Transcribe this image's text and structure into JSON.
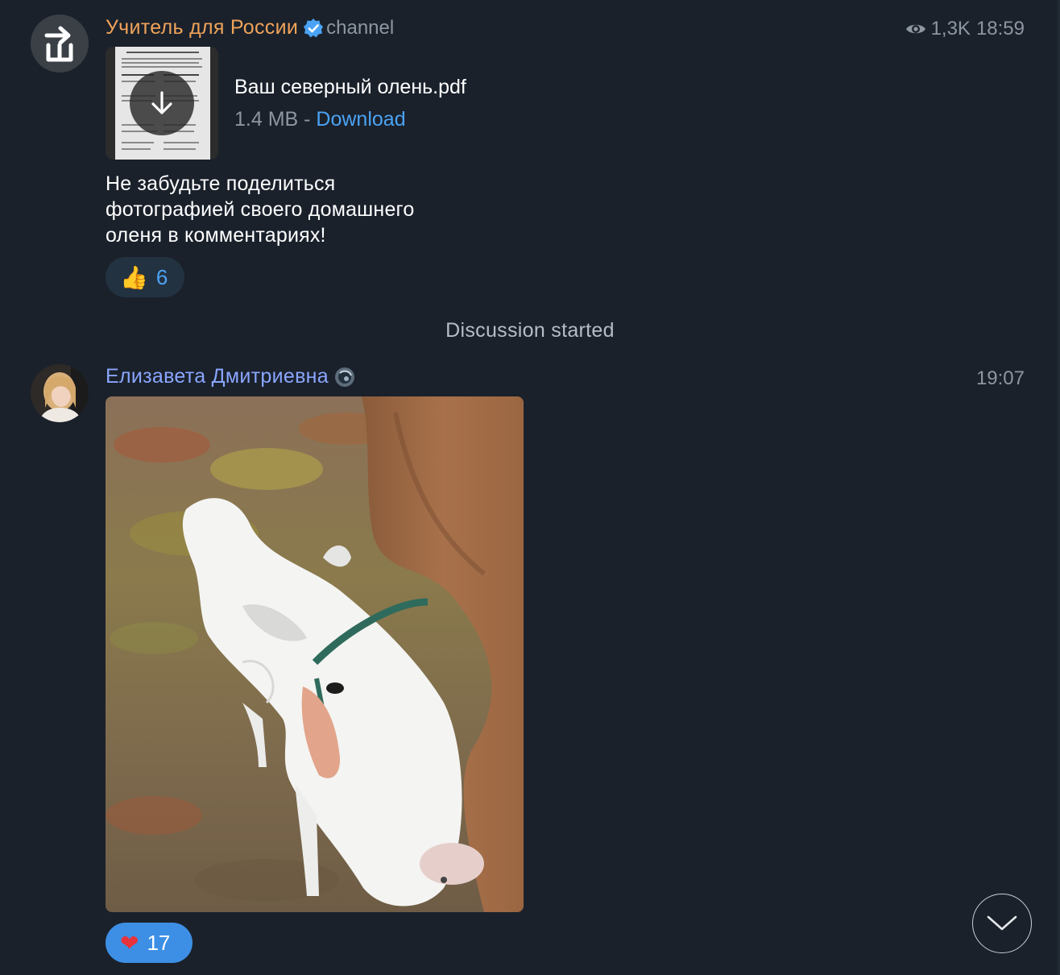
{
  "channel_post": {
    "sender": "Учитель для России",
    "tag": "channel",
    "views": "1,3K",
    "time": "18:59",
    "document": {
      "name": "Ваш северный олень.pdf",
      "size": "1.4 MB",
      "separator": " - ",
      "action": "Download"
    },
    "text_lines": [
      "Не забудьте поделиться",
      "фотографией своего домашнего",
      "оленя в комментариях!"
    ],
    "reaction": {
      "emoji": "👍",
      "count": "6"
    }
  },
  "service": {
    "label": "Discussion started"
  },
  "comment": {
    "sender": "Елизавета Дмитриевна",
    "time": "19:07",
    "reaction": {
      "emoji": "❤",
      "count": "17"
    }
  },
  "colors": {
    "background": "#1a212b",
    "channel_name": "#f0a35a",
    "user_name": "#8aa6ff",
    "link": "#4ba3f5",
    "meta": "#8d96a1"
  },
  "icons": [
    "channel-logo-icon",
    "verified-icon",
    "eye-icon",
    "download-arrow-icon",
    "status-emoji-icon",
    "chevron-down-icon"
  ]
}
